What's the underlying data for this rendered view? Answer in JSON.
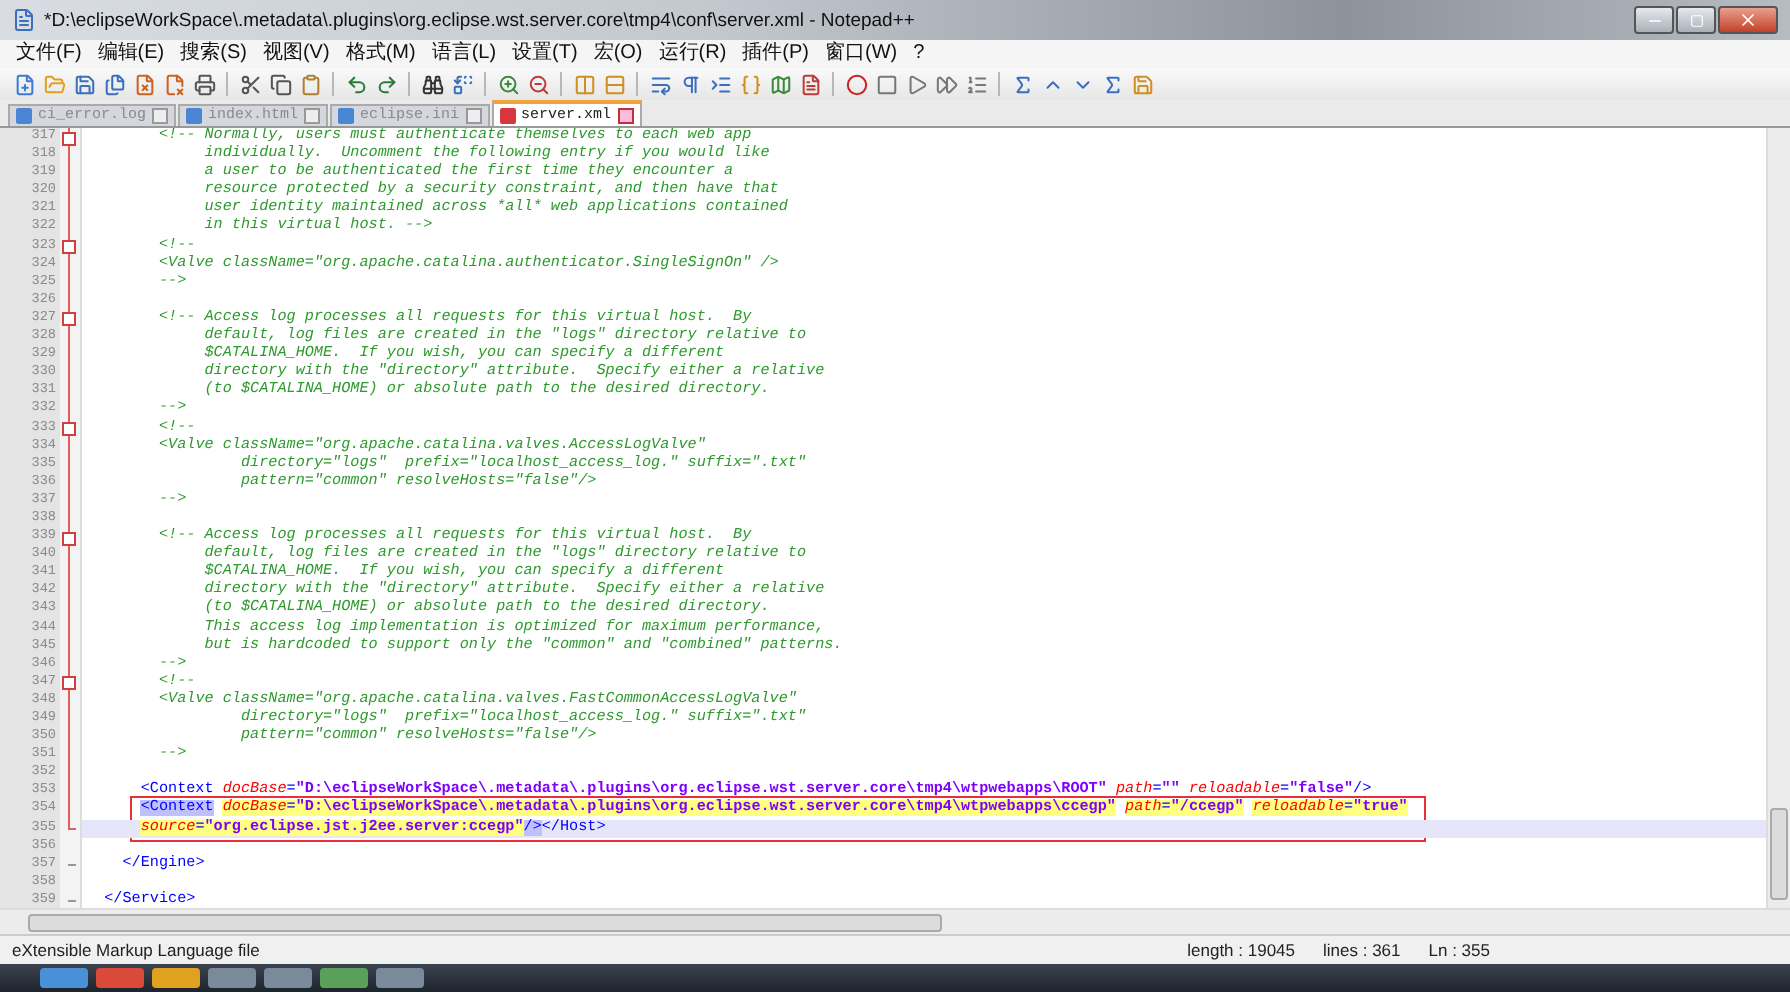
{
  "window": {
    "title": "*D:\\eclipseWorkSpace\\.metadata\\.plugins\\org.eclipse.wst.server.core\\tmp4\\conf\\server.xml - Notepad++"
  },
  "menu": [
    "文件(F)",
    "编辑(E)",
    "搜索(S)",
    "视图(V)",
    "格式(M)",
    "语言(L)",
    "设置(T)",
    "宏(O)",
    "运行(R)",
    "插件(P)",
    "窗口(W)",
    "?"
  ],
  "tabs": [
    {
      "label": "ci_error.log",
      "selected": false,
      "modified": false
    },
    {
      "label": "index.html",
      "selected": false,
      "modified": false
    },
    {
      "label": "eclipse.ini",
      "selected": false,
      "modified": false
    },
    {
      "label": "server.xml",
      "selected": true,
      "modified": true
    }
  ],
  "lines": [
    {
      "number": "317",
      "fold_start": true,
      "in_fold": true,
      "fold_end": false,
      "current": false,
      "boxed": false,
      "segments": [
        {
          "kind": "comment",
          "text": "        <!-- Normally, users must authenticate themselves to each web app"
        }
      ]
    },
    {
      "number": "318",
      "fold_start": false,
      "in_fold": true,
      "fold_end": false,
      "current": false,
      "boxed": false,
      "segments": [
        {
          "kind": "comment",
          "text": "             individually.  Uncomment the following entry if you would like"
        }
      ]
    },
    {
      "number": "319",
      "fold_start": false,
      "in_fold": true,
      "fold_end": false,
      "current": false,
      "boxed": false,
      "segments": [
        {
          "kind": "comment",
          "text": "             a user to be authenticated the first time they encounter a"
        }
      ]
    },
    {
      "number": "320",
      "fold_start": false,
      "in_fold": true,
      "fold_end": false,
      "current": false,
      "boxed": false,
      "segments": [
        {
          "kind": "comment",
          "text": "             resource protected by a security constraint, and then have that"
        }
      ]
    },
    {
      "number": "321",
      "fold_start": false,
      "in_fold": true,
      "fold_end": false,
      "current": false,
      "boxed": false,
      "segments": [
        {
          "kind": "comment",
          "text": "             user identity maintained across *all* web applications contained"
        }
      ]
    },
    {
      "number": "322",
      "fold_start": false,
      "in_fold": true,
      "fold_end": false,
      "current": false,
      "boxed": false,
      "segments": [
        {
          "kind": "comment",
          "text": "             in this virtual host. -->"
        }
      ]
    },
    {
      "number": "323",
      "fold_start": true,
      "in_fold": true,
      "fold_end": false,
      "current": false,
      "boxed": false,
      "segments": [
        {
          "kind": "comment",
          "text": "        <!--"
        }
      ]
    },
    {
      "number": "324",
      "fold_start": false,
      "in_fold": true,
      "fold_end": false,
      "current": false,
      "boxed": false,
      "segments": [
        {
          "kind": "comment",
          "text": "        <Valve className=\"org.apache.catalina.authenticator.SingleSignOn\" />"
        }
      ]
    },
    {
      "number": "325",
      "fold_start": false,
      "in_fold": true,
      "fold_end": false,
      "current": false,
      "boxed": false,
      "segments": [
        {
          "kind": "comment",
          "text": "        -->"
        }
      ]
    },
    {
      "number": "326",
      "fold_start": false,
      "in_fold": true,
      "fold_end": false,
      "current": false,
      "boxed": false
    },
    {
      "number": "327",
      "fold_start": true,
      "in_fold": true,
      "fold_end": false,
      "current": false,
      "boxed": false,
      "segments": [
        {
          "kind": "comment",
          "text": "        <!-- Access log processes all requests for this virtual host.  By"
        }
      ]
    },
    {
      "number": "328",
      "fold_start": false,
      "in_fold": true,
      "fold_end": false,
      "current": false,
      "boxed": false,
      "segments": [
        {
          "kind": "comment",
          "text": "             default, log files are created in the \"logs\" directory relative to"
        }
      ]
    },
    {
      "number": "329",
      "fold_start": false,
      "in_fold": true,
      "fold_end": false,
      "current": false,
      "boxed": false,
      "segments": [
        {
          "kind": "comment",
          "text": "             $CATALINA_HOME.  If you wish, you can specify a different"
        }
      ]
    },
    {
      "number": "330",
      "fold_start": false,
      "in_fold": true,
      "fold_end": false,
      "current": false,
      "boxed": false,
      "segments": [
        {
          "kind": "comment",
          "text": "             directory with the \"directory\" attribute.  Specify either a relative"
        }
      ]
    },
    {
      "number": "331",
      "fold_start": false,
      "in_fold": true,
      "fold_end": false,
      "current": false,
      "boxed": false,
      "segments": [
        {
          "kind": "comment",
          "text": "             (to $CATALINA_HOME) or absolute path to the desired directory."
        }
      ]
    },
    {
      "number": "332",
      "fold_start": false,
      "in_fold": true,
      "fold_end": false,
      "current": false,
      "boxed": false,
      "segments": [
        {
          "kind": "comment",
          "text": "        -->"
        }
      ]
    },
    {
      "number": "333",
      "fold_start": true,
      "in_fold": true,
      "fold_end": false,
      "current": false,
      "boxed": false,
      "segments": [
        {
          "kind": "comment",
          "text": "        <!--"
        }
      ]
    },
    {
      "number": "334",
      "fold_start": false,
      "in_fold": true,
      "fold_end": false,
      "current": false,
      "boxed": false,
      "segments": [
        {
          "kind": "comment",
          "text": "        <Valve className=\"org.apache.catalina.valves.AccessLogValve\""
        }
      ]
    },
    {
      "number": "335",
      "fold_start": false,
      "in_fold": true,
      "fold_end": false,
      "current": false,
      "boxed": false,
      "segments": [
        {
          "kind": "comment",
          "text": "                 directory=\"logs\"  prefix=\"localhost_access_log.\" suffix=\".txt\""
        }
      ]
    },
    {
      "number": "336",
      "fold_start": false,
      "in_fold": true,
      "fold_end": false,
      "current": false,
      "boxed": false,
      "segments": [
        {
          "kind": "comment",
          "text": "                 pattern=\"common\" resolveHosts=\"false\"/>"
        }
      ]
    },
    {
      "number": "337",
      "fold_start": false,
      "in_fold": true,
      "fold_end": false,
      "current": false,
      "boxed": false,
      "segments": [
        {
          "kind": "comment",
          "text": "        -->"
        }
      ]
    },
    {
      "number": "338",
      "fold_start": false,
      "in_fold": true,
      "fold_end": false,
      "current": false,
      "boxed": false
    },
    {
      "number": "339",
      "fold_start": true,
      "in_fold": true,
      "fold_end": false,
      "current": false,
      "boxed": false,
      "segments": [
        {
          "kind": "comment",
          "text": "        <!-- Access log processes all requests for this virtual host.  By"
        }
      ]
    },
    {
      "number": "340",
      "fold_start": false,
      "in_fold": true,
      "fold_end": false,
      "current": false,
      "boxed": false,
      "segments": [
        {
          "kind": "comment",
          "text": "             default, log files are created in the \"logs\" directory relative to"
        }
      ]
    },
    {
      "number": "341",
      "fold_start": false,
      "in_fold": true,
      "fold_end": false,
      "current": false,
      "boxed": false,
      "segments": [
        {
          "kind": "comment",
          "text": "             $CATALINA_HOME.  If you wish, you can specify a different"
        }
      ]
    },
    {
      "number": "342",
      "fold_start": false,
      "in_fold": true,
      "fold_end": false,
      "current": false,
      "boxed": false,
      "segments": [
        {
          "kind": "comment",
          "text": "             directory with the \"directory\" attribute.  Specify either a relative"
        }
      ]
    },
    {
      "number": "343",
      "fold_start": false,
      "in_fold": true,
      "fold_end": false,
      "current": false,
      "boxed": false,
      "segments": [
        {
          "kind": "comment",
          "text": "             (to $CATALINA_HOME) or absolute path to the desired directory."
        }
      ]
    },
    {
      "number": "344",
      "fold_start": false,
      "in_fold": true,
      "fold_end": false,
      "current": false,
      "boxed": false,
      "segments": [
        {
          "kind": "comment",
          "text": "             This access log implementation is optimized for maximum performance,"
        }
      ]
    },
    {
      "number": "345",
      "fold_start": false,
      "in_fold": true,
      "fold_end": false,
      "current": false,
      "boxed": false,
      "segments": [
        {
          "kind": "comment",
          "text": "             but is hardcoded to support only the \"common\" and \"combined\" patterns."
        }
      ]
    },
    {
      "number": "346",
      "fold_start": false,
      "in_fold": true,
      "fold_end": false,
      "current": false,
      "boxed": false,
      "segments": [
        {
          "kind": "comment",
          "text": "        -->"
        }
      ]
    },
    {
      "number": "347",
      "fold_start": true,
      "in_fold": true,
      "fold_end": false,
      "current": false,
      "boxed": false,
      "segments": [
        {
          "kind": "comment",
          "text": "        <!--"
        }
      ]
    },
    {
      "number": "348",
      "fold_start": false,
      "in_fold": true,
      "fold_end": false,
      "current": false,
      "boxed": false,
      "segments": [
        {
          "kind": "comment",
          "text": "        <Valve className=\"org.apache.catalina.valves.FastCommonAccessLogValve\""
        }
      ]
    },
    {
      "number": "349",
      "fold_start": false,
      "in_fold": true,
      "fold_end": false,
      "current": false,
      "boxed": false,
      "segments": [
        {
          "kind": "comment",
          "text": "                 directory=\"logs\"  prefix=\"localhost_access_log.\" suffix=\".txt\""
        }
      ]
    },
    {
      "number": "350",
      "fold_start": false,
      "in_fold": true,
      "fold_end": false,
      "current": false,
      "boxed": false,
      "segments": [
        {
          "kind": "comment",
          "text": "                 pattern=\"common\" resolveHosts=\"false\"/>"
        }
      ]
    },
    {
      "number": "351",
      "fold_start": false,
      "in_fold": true,
      "fold_end": false,
      "current": false,
      "boxed": false,
      "segments": [
        {
          "kind": "comment",
          "text": "        -->"
        }
      ]
    },
    {
      "number": "352",
      "fold_start": false,
      "in_fold": true,
      "fold_end": false,
      "current": false,
      "boxed": false
    },
    {
      "number": "353",
      "fold_start": false,
      "in_fold": true,
      "fold_end": false,
      "current": false,
      "boxed": false,
      "segments": [
        {
          "kind": "tag",
          "text": "      <Context",
          "found": false,
          "selected": false
        },
        {
          "kind": "attr",
          "text": " docBase",
          "found": false,
          "selected": false
        },
        {
          "kind": "tag",
          "text": "=",
          "found": false,
          "selected": false
        },
        {
          "kind": "value",
          "text": "\"D:\\eclipseWorkSpace\\.metadata\\.plugins\\org.eclipse.wst.server.core\\tmp4\\wtpwebapps\\ROOT\"",
          "found": false,
          "selected": false
        },
        {
          "kind": "attr",
          "text": " path",
          "found": false,
          "selected": false
        },
        {
          "kind": "tag",
          "text": "=",
          "found": false,
          "selected": false
        },
        {
          "kind": "value",
          "text": "\"\"",
          "found": false,
          "selected": false
        },
        {
          "kind": "attr",
          "text": " reloadable",
          "found": false,
          "selected": false
        },
        {
          "kind": "tag",
          "text": "=",
          "found": false,
          "selected": false
        },
        {
          "kind": "value",
          "text": "\"false\"",
          "found": false,
          "selected": false
        },
        {
          "kind": "tag",
          "text": "/>",
          "found": false,
          "selected": false
        }
      ]
    },
    {
      "number": "354",
      "fold_start": false,
      "in_fold": true,
      "fold_end": false,
      "current": false,
      "boxed": true,
      "segments": [
        {
          "kind": "tag",
          "text": "      <Context",
          "found": false,
          "selected": true
        },
        {
          "kind": "attr",
          "text": " docBase",
          "found": true,
          "selected": false
        },
        {
          "kind": "tag",
          "text": "=",
          "found": true,
          "selected": false
        },
        {
          "kind": "value",
          "text": "\"D:\\eclipseWorkSpace\\.metadata\\.plugins\\org.eclipse.wst.server.core\\tmp4\\wtpwebapps\\ccegp\"",
          "found": true,
          "selected": false
        },
        {
          "kind": "attr",
          "text": " path",
          "found": true,
          "selected": false
        },
        {
          "kind": "tag",
          "text": "=",
          "found": true,
          "selected": false
        },
        {
          "kind": "value",
          "text": "\"/ccegp\"",
          "found": true,
          "selected": false
        },
        {
          "kind": "attr",
          "text": " reloadable",
          "found": true,
          "selected": false
        },
        {
          "kind": "tag",
          "text": "=",
          "found": true,
          "selected": false
        },
        {
          "kind": "value",
          "text": "\"true\"",
          "found": true,
          "selected": false
        }
      ]
    },
    {
      "number": "355",
      "fold_start": false,
      "in_fold": true,
      "fold_end": true,
      "current": true,
      "boxed": true,
      "segments": [
        {
          "kind": "attr",
          "text": "      source",
          "found": true,
          "selected": false
        },
        {
          "kind": "tag",
          "text": "=",
          "found": true,
          "selected": false
        },
        {
          "kind": "value",
          "text": "\"org.eclipse.jst.j2ee.server:ccegp\"",
          "found": true,
          "selected": false
        },
        {
          "kind": "tag",
          "text": "/>",
          "found": false,
          "selected": true
        },
        {
          "kind": "tag",
          "text": "</Host>",
          "found": false,
          "selected": false
        }
      ]
    },
    {
      "number": "356",
      "fold_start": false,
      "in_fold": false,
      "fold_end": false,
      "current": false,
      "boxed": false
    },
    {
      "number": "357",
      "fold_start": false,
      "in_fold": false,
      "fold_end": true,
      "current": false,
      "boxed": false,
      "segments": [
        {
          "kind": "tag",
          "text": "    </Engine>",
          "found": false,
          "selected": false
        }
      ]
    },
    {
      "number": "358",
      "fold_start": false,
      "in_fold": false,
      "fold_end": false,
      "current": false,
      "boxed": false
    },
    {
      "number": "359",
      "fold_start": false,
      "in_fold": false,
      "fold_end": true,
      "current": false,
      "boxed": false,
      "segments": [
        {
          "kind": "tag",
          "text": "  </Service>",
          "found": false,
          "selected": false
        }
      ]
    }
  ],
  "status_bar": {
    "file_type": "eXtensible Markup Language file",
    "fields": [
      "length : 19045",
      "lines : 361",
      "Ln : 355"
    ]
  }
}
